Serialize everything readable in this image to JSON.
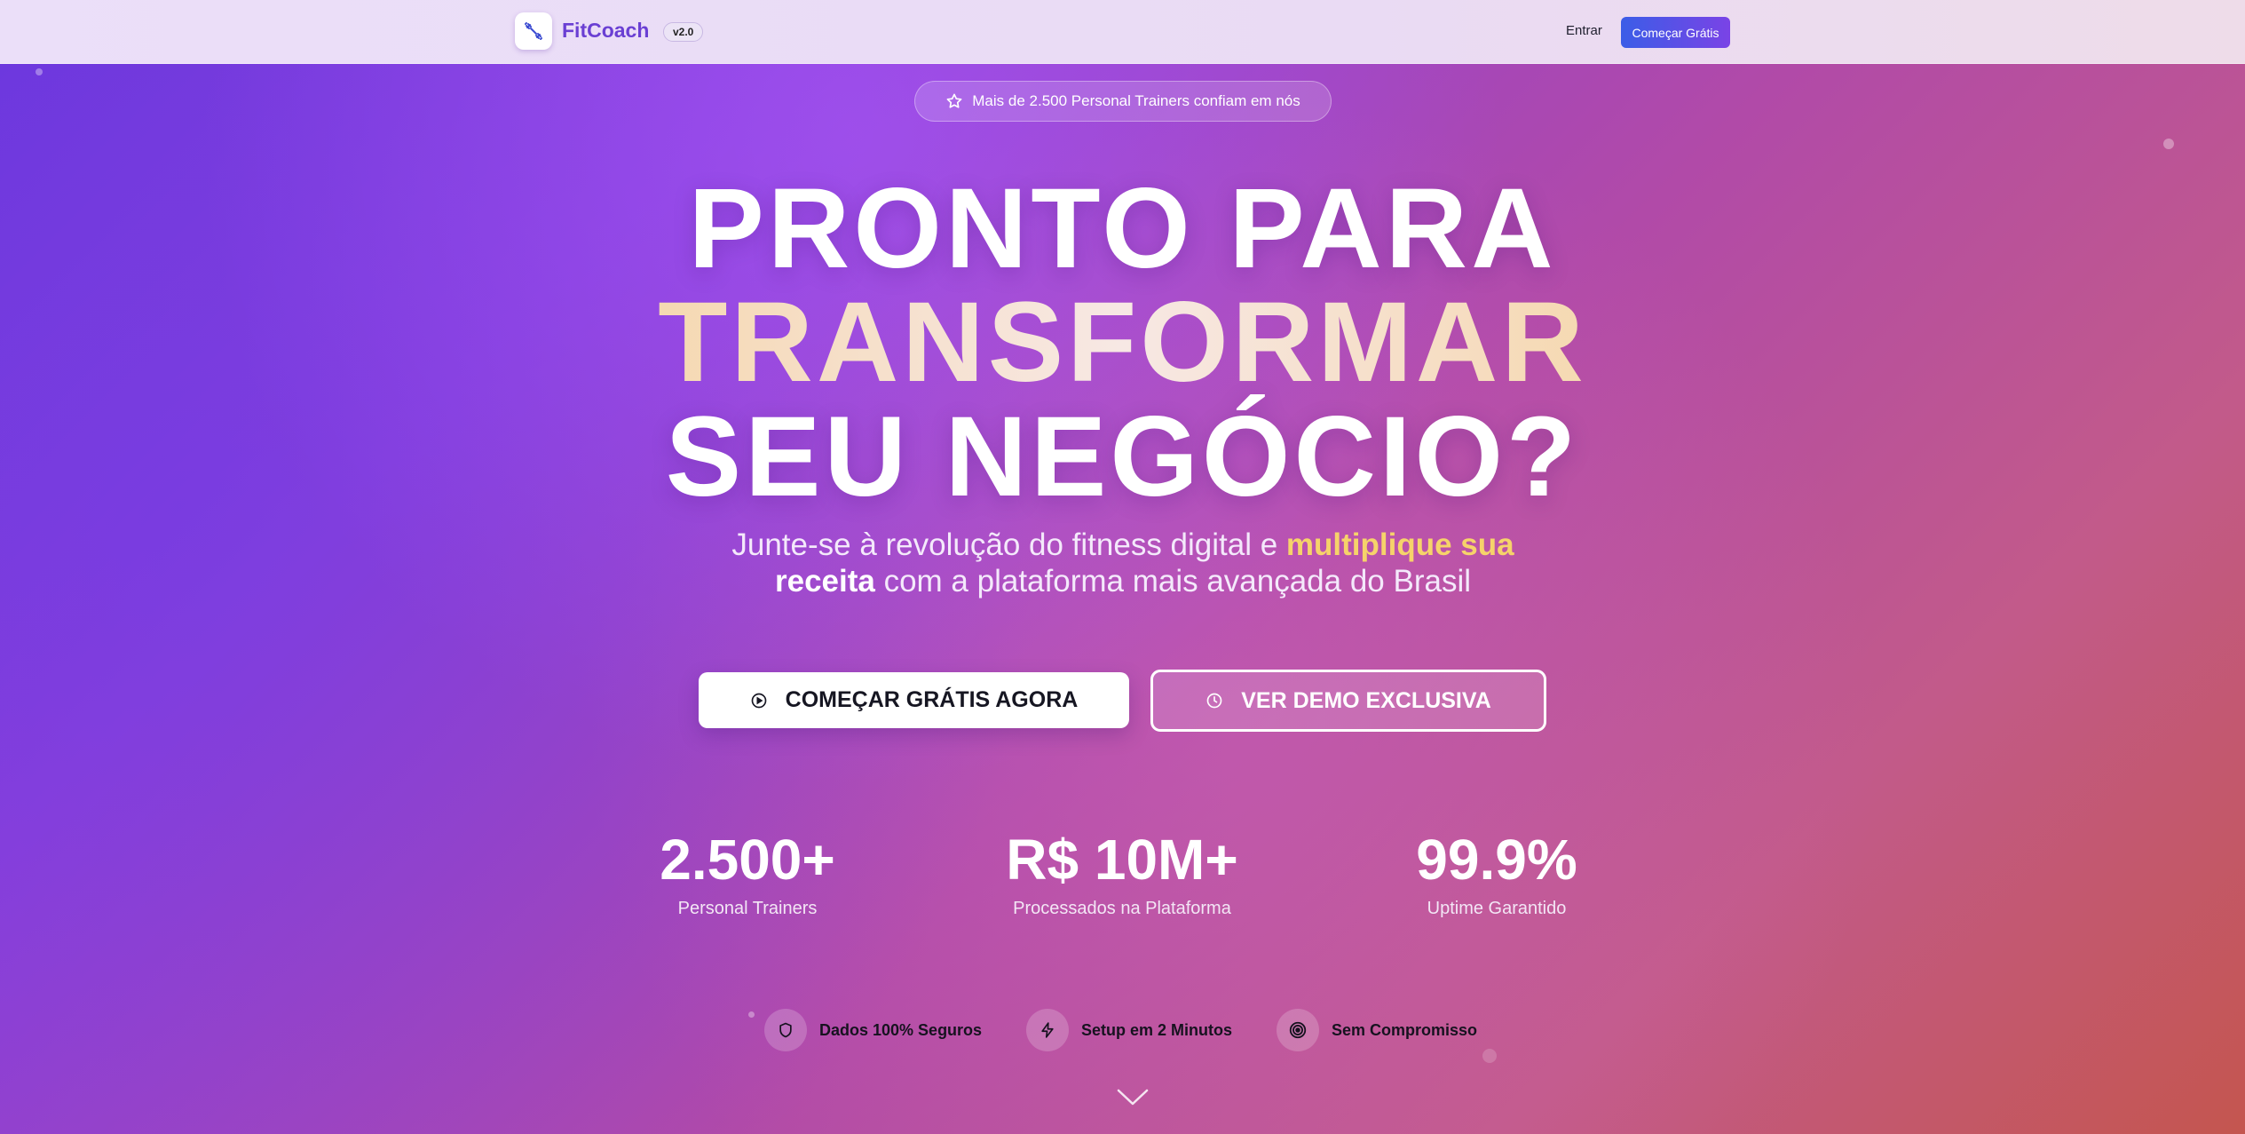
{
  "header": {
    "brand": "FitCoach",
    "version": "v2.0",
    "login": "Entrar",
    "cta": "Começar Grátis"
  },
  "hero": {
    "badge": "Mais de 2.500 Personal Trainers confiam em nós",
    "headline_line1": "PRONTO PARA",
    "headline_line2": "TRANSFORMAR",
    "headline_line3": "SEU NEGÓCIO?",
    "subtitle_part1": "Junte-se à revolução do fitness digital e ",
    "subtitle_highlight": "multiplique sua",
    "subtitle_bold": "receita",
    "subtitle_part2": " com a plataforma mais avançada do Brasil",
    "primary_button": "COMEÇAR GRÁTIS AGORA",
    "secondary_button": "VER DEMO EXCLUSIVA"
  },
  "stats": [
    {
      "value": "2.500+",
      "label": "Personal Trainers"
    },
    {
      "value": "R$ 10M+",
      "label": "Processados na Plataforma"
    },
    {
      "value": "99.9%",
      "label": "Uptime Garantido"
    }
  ],
  "features": [
    {
      "icon": "shield-icon",
      "label": "Dados 100% Seguros"
    },
    {
      "icon": "lightning-icon",
      "label": "Setup em 2 Minutos"
    },
    {
      "icon": "target-icon",
      "label": "Sem Compromisso"
    }
  ],
  "colors": {
    "brand": "#6a3fd3",
    "accent_gold": "#f1c75a",
    "cta_gradient_start": "#3b5de7",
    "cta_gradient_end": "#7a43e6"
  }
}
